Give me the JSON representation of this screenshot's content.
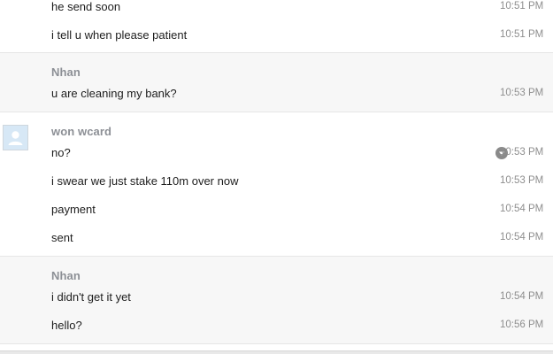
{
  "groups": [
    {
      "sender": "",
      "messages": [
        {
          "text": "he send soon",
          "time": "10:51 PM"
        },
        {
          "text": "i tell u when please patient",
          "time": "10:51 PM"
        }
      ]
    },
    {
      "sender": "Nhan",
      "messages": [
        {
          "text": "u are cleaning my bank?",
          "time": "10:53 PM"
        }
      ]
    },
    {
      "sender": "won wcard",
      "avatar": "default-user-avatar",
      "messages": [
        {
          "text": "no?",
          "time": "10:53 PM",
          "icon": "chevron-down-circle-icon"
        },
        {
          "text": "i swear we just stake 110m over now",
          "time": "10:53 PM"
        },
        {
          "text": "payment",
          "time": "10:54 PM"
        },
        {
          "text": "sent",
          "time": "10:54 PM"
        }
      ]
    },
    {
      "sender": "Nhan",
      "messages": [
        {
          "text": "i didn't get it yet",
          "time": "10:54 PM"
        },
        {
          "text": "hello?",
          "time": "10:56 PM"
        }
      ]
    }
  ],
  "colors": {
    "alt_background": "#f7f7f7",
    "sender_name": "#8c8f95",
    "timestamp": "#8e8e8e",
    "message_text": "#1d1d1d"
  }
}
